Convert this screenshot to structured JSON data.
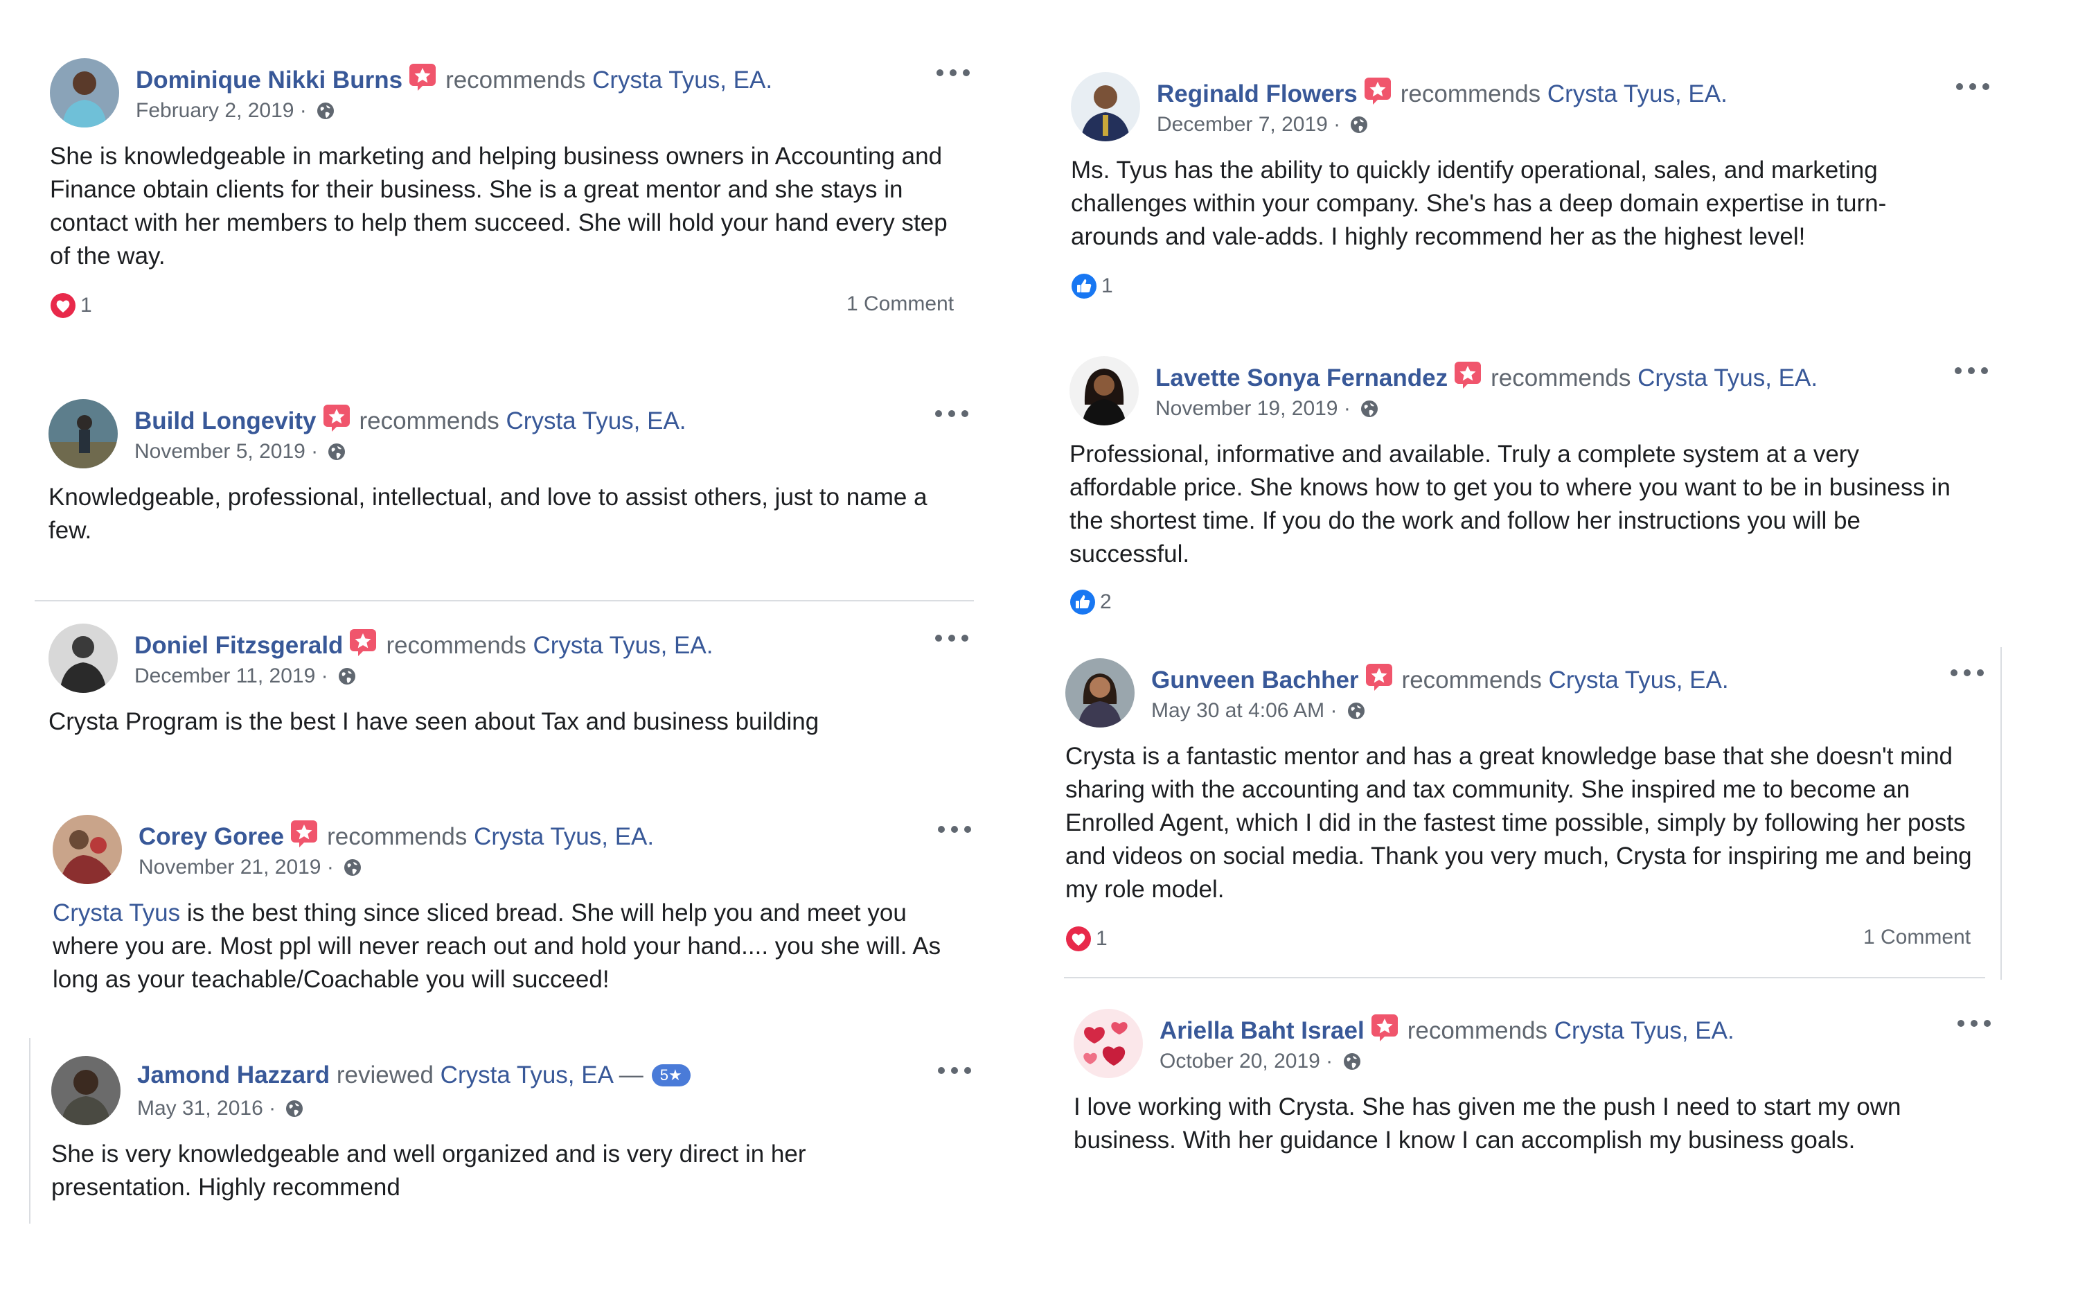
{
  "recommends_text": "recommends",
  "page_name": "Crysta Tyus, EA.",
  "colors": {
    "link": "#385898",
    "secondary": "#606770",
    "love": "#e8294a",
    "like": "#1877f2",
    "recommend_badge": "#f0556c"
  },
  "posts": [
    {
      "author": "Dominique Nikki Burns",
      "date": "February 2, 2019 ·",
      "body": "She is knowledgeable in marketing and helping business owners in Accounting and Finance obtain clients for their business. She is a great mentor and she stays in contact with her members to help them succeed. She will hold your hand every step of the way.",
      "reaction": {
        "type": "love",
        "count": "1"
      },
      "comments": "1 Comment"
    },
    {
      "author": "Build Longevity",
      "date": "November 5, 2019 ·",
      "body": "Knowledgeable, professional, intellectual, and love to assist others, just to name a few."
    },
    {
      "author": "Doniel Fitzsgerald",
      "date": "December 11, 2019 ·",
      "body": "Crysta Program is the best I have seen about Tax and business building"
    },
    {
      "author": "Corey Goree",
      "date": "November 21, 2019 ·",
      "body_link": "Crysta Tyus",
      "body": " is the best thing since sliced bread. She will help you and meet you where you are. Most ppl will never reach out and hold your hand.... you she will. As long as your teachable/Coachable you will succeed!"
    },
    {
      "author": "Jamond Hazzard",
      "verb": "reviewed",
      "page": "Crysta Tyus, EA",
      "dash": " —",
      "stars": "5★",
      "date": "May 31, 2016 ·",
      "body": "She is very knowledgeable and well organized and is very direct in her presentation. Highly recommend"
    },
    {
      "author": "Reginald Flowers",
      "date": "December 7, 2019 ·",
      "body": "Ms. Tyus has the ability to quickly identify operational, sales, and marketing challenges within your company. She's has a deep domain expertise in turn-arounds and vale-adds. I highly recommend her as the highest level!",
      "reaction": {
        "type": "like",
        "count": "1"
      }
    },
    {
      "author": "Lavette Sonya Fernandez",
      "date": "November 19, 2019 ·",
      "body": "Professional, informative and available. Truly a complete system at a very affordable price. She knows how to get you to where you want to be in business in the shortest time. If you do the work and follow her instructions you will be successful.",
      "reaction": {
        "type": "like",
        "count": "2"
      }
    },
    {
      "author": "Gunveen Bachher",
      "date": "May 30 at 4:06 AM ·",
      "body": "Crysta is a fantastic mentor and has a great knowledge base that she doesn't mind sharing with the accounting and tax community. She inspired me to become an Enrolled Agent, which I did in the fastest time possible, simply by following her posts and videos on social media. Thank you very much, Crysta for inspiring me and being my role model.",
      "reaction": {
        "type": "love",
        "count": "1"
      },
      "comments": "1 Comment"
    },
    {
      "author": "Ariella Baht Israel",
      "date": "October 20, 2019 ·",
      "body": "I love working with Crysta. She has given me the push I need to start my own business. With her guidance I know I can accomplish my business goals."
    }
  ]
}
